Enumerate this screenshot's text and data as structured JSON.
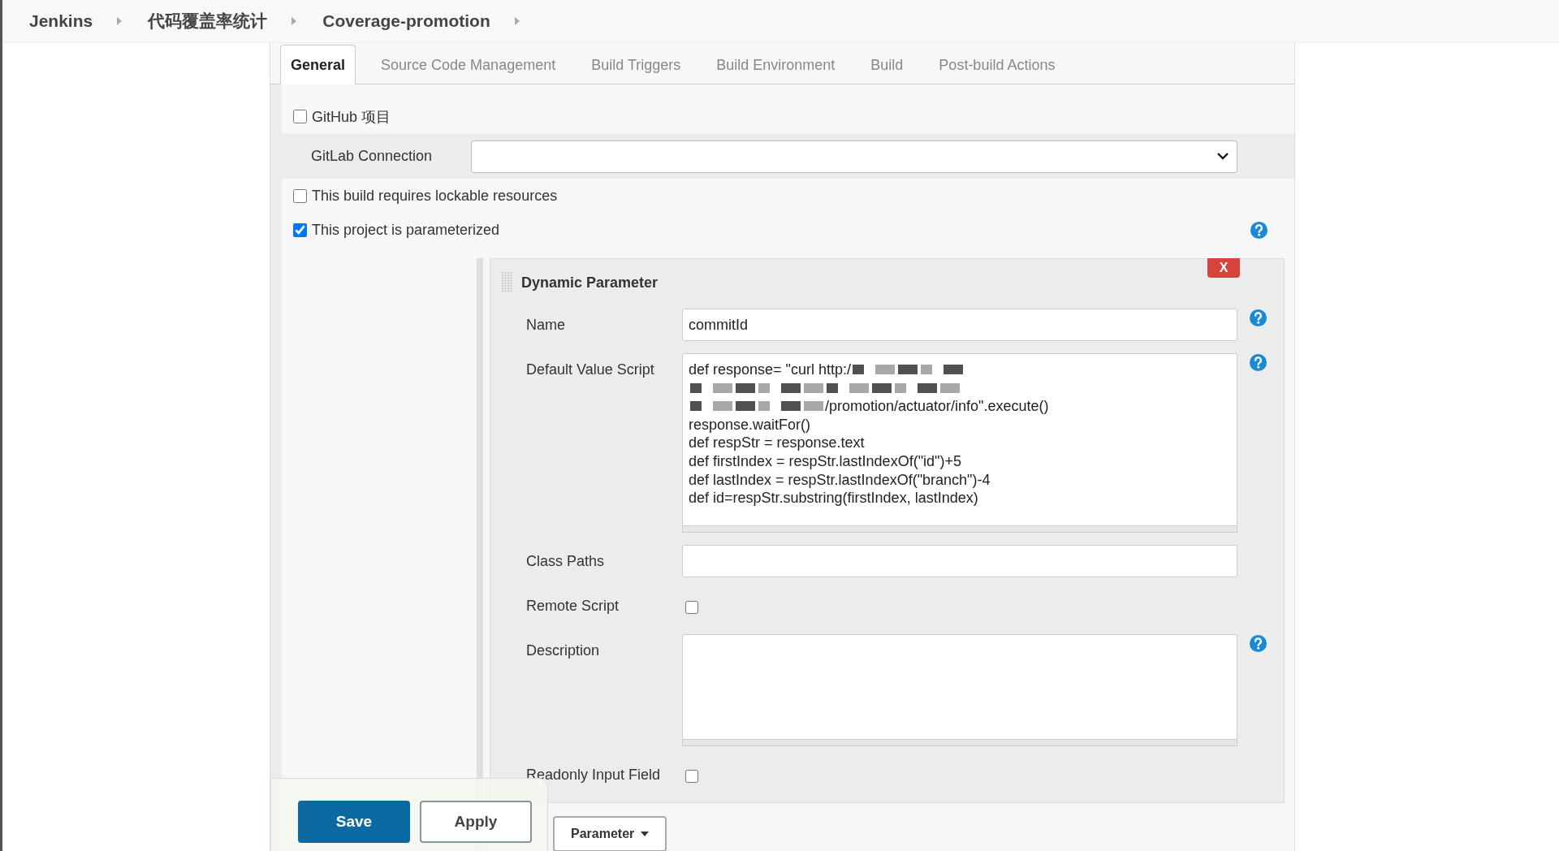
{
  "breadcrumbs": [
    {
      "label": "Jenkins"
    },
    {
      "label": "代码覆盖率统计"
    },
    {
      "label": "Coverage-promotion"
    }
  ],
  "tabs": [
    {
      "label": "General",
      "selected": true
    },
    {
      "label": "Source Code Management",
      "selected": false
    },
    {
      "label": "Build Triggers",
      "selected": false
    },
    {
      "label": "Build Environment",
      "selected": false
    },
    {
      "label": "Build",
      "selected": false
    },
    {
      "label": "Post-build Actions",
      "selected": false
    }
  ],
  "options": [
    {
      "kind": "checkbox",
      "label": "GitHub 项目",
      "checked": false,
      "help": false
    },
    {
      "kind": "select",
      "label": "GitLab Connection",
      "help": false
    },
    {
      "kind": "checkbox",
      "label": "This build requires lockable resources",
      "checked": false,
      "help": false
    },
    {
      "kind": "checkbox",
      "label": "This project is parameterized",
      "checked": true,
      "help": true
    }
  ],
  "parameter": {
    "title": "Dynamic Parameter",
    "delete_button": "X",
    "fields": [
      {
        "kind": "text",
        "label": "Name",
        "value": "commitId",
        "help": true
      },
      {
        "kind": "script",
        "label": "Default Value Script",
        "help": true,
        "lines": [
          {
            "kind": "redacted_end",
            "text": "def response= \"curl http:/"
          },
          {
            "kind": "redacted"
          },
          {
            "kind": "redacted_start",
            "text": "/promotion/actuator/info\".execute()"
          },
          {
            "text": "response.waitFor()"
          },
          {
            "text": "def respStr = response.text"
          },
          {
            "text": "def firstIndex = respStr.lastIndexOf(\"id\")+5"
          },
          {
            "text": "def lastIndex = respStr.lastIndexOf(\"branch\")-4"
          },
          {
            "text": "def id=respStr.substring(firstIndex, lastIndex)"
          }
        ]
      },
      {
        "kind": "text",
        "label": "Class Paths",
        "help": false
      },
      {
        "kind": "checkbox",
        "label": "Remote Script",
        "checked": false,
        "help": false
      },
      {
        "kind": "textarea",
        "label": "Description",
        "help": true
      },
      {
        "kind": "checkbox",
        "label": "Readonly Input Field",
        "checked": false,
        "help": false
      }
    ]
  },
  "add_button": "Parameter",
  "buttons": [
    {
      "label": "Save",
      "primary": true
    },
    {
      "label": "Apply",
      "primary": false
    }
  ]
}
